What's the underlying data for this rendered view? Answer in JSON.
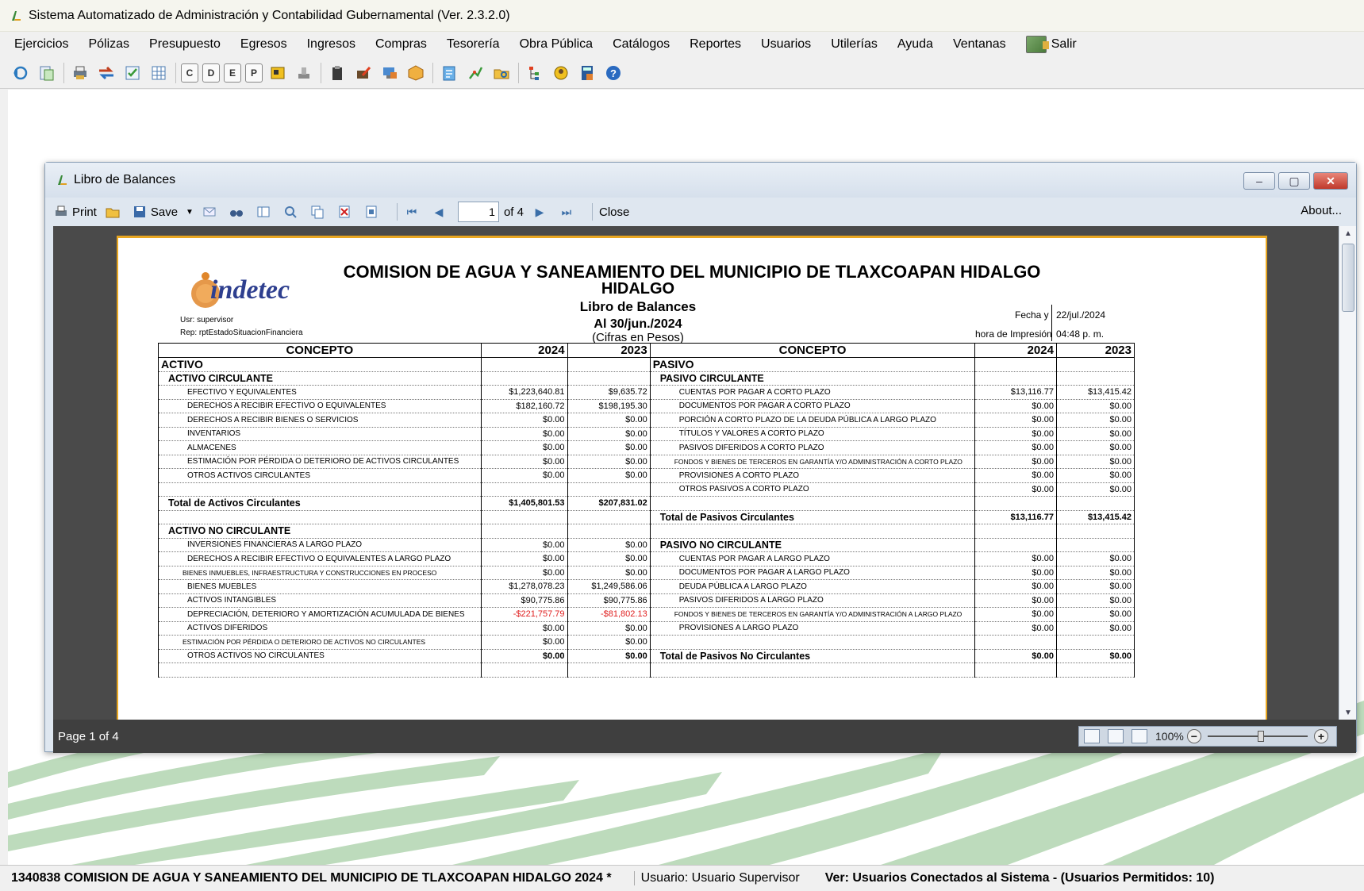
{
  "app": {
    "title": "Sistema Automatizado de Administración y Contabilidad Gubernamental  (Ver. 2.3.2.0)",
    "menu": [
      "Ejercicios",
      "Pólizas",
      "Presupuesto",
      "Egresos",
      "Ingresos",
      "Compras",
      "Tesorería",
      "Obra Pública",
      "Catálogos",
      "Reportes",
      "Usuarios",
      "Utilerías",
      "Ayuda",
      "Ventanas"
    ],
    "exit_label": "Salir",
    "toolbar_letters": [
      "C",
      "D",
      "E",
      "P"
    ]
  },
  "report_window": {
    "title": "Libro de Balances",
    "toolbar": {
      "print": "Print",
      "save": "Save",
      "page_value": "1",
      "page_of": "of 4",
      "close": "Close",
      "about": "About..."
    },
    "status": "Page 1 of 4",
    "zoom": "100%"
  },
  "report": {
    "org_title": "COMISION DE AGUA Y SANEAMIENTO DEL MUNICIPIO DE TLAXCOAPAN HIDALGO",
    "org_title2": "HIDALGO",
    "name": "Libro de Balances",
    "date": "Al 30/jun./2024",
    "units": "(Cifras en Pesos)",
    "usr": "Usr: supervisor",
    "rep": "Rep: rptEstadoSituacionFinanciera",
    "fecha_label": "Fecha y",
    "fecha_value": "22/jul./2024",
    "hora_label": "hora de Impresión",
    "hora_value": "04:48 p. m.",
    "logo_text": "indetec",
    "headers": {
      "concepto": "CONCEPTO",
      "y1": "2024",
      "y2": "2023"
    },
    "rows": [
      {
        "l": "ACTIVO",
        "lt": "sec",
        "a": "",
        "b": "",
        "r": "PASIVO",
        "rt": "sec",
        "c": "",
        "d": ""
      },
      {
        "l": "ACTIVO CIRCULANTE",
        "lt": "sub",
        "a": "",
        "b": "",
        "r": "PASIVO CIRCULANTE",
        "rt": "sub",
        "c": "",
        "d": ""
      },
      {
        "l": "EFECTIVO Y EQUIVALENTES",
        "lt": "item",
        "a": "$1,223,640.81",
        "b": "$9,635.72",
        "r": "CUENTAS POR PAGAR A CORTO PLAZO",
        "rt": "item",
        "c": "$13,116.77",
        "d": "$13,415.42"
      },
      {
        "l": "DERECHOS A RECIBIR EFECTIVO O EQUIVALENTES",
        "lt": "item",
        "a": "$182,160.72",
        "b": "$198,195.30",
        "r": "DOCUMENTOS POR PAGAR A CORTO PLAZO",
        "rt": "item",
        "c": "$0.00",
        "d": "$0.00"
      },
      {
        "l": "DERECHOS A RECIBIR BIENES O SERVICIOS",
        "lt": "item",
        "a": "$0.00",
        "b": "$0.00",
        "r": "PORCIÓN A CORTO PLAZO DE LA DEUDA PÚBLICA A LARGO PLAZO",
        "rt": "item",
        "c": "$0.00",
        "d": "$0.00"
      },
      {
        "l": "INVENTARIOS",
        "lt": "item",
        "a": "$0.00",
        "b": "$0.00",
        "r": "TÍTULOS Y VALORES A CORTO PLAZO",
        "rt": "item",
        "c": "$0.00",
        "d": "$0.00"
      },
      {
        "l": "ALMACENES",
        "lt": "item",
        "a": "$0.00",
        "b": "$0.00",
        "r": "PASIVOS DIFERIDOS A CORTO PLAZO",
        "rt": "item",
        "c": "$0.00",
        "d": "$0.00"
      },
      {
        "l": "ESTIMACIÓN POR PÉRDIDA O DETERIORO DE ACTIVOS CIRCULANTES",
        "lt": "item",
        "a": "$0.00",
        "b": "$0.00",
        "r": "FONDOS Y BIENES DE TERCEROS EN GARANTÍA Y/O ADMINISTRACIÓN A CORTO PLAZO",
        "rt": "item small",
        "c": "$0.00",
        "d": "$0.00"
      },
      {
        "l": "OTROS ACTIVOS CIRCULANTES",
        "lt": "item",
        "a": "$0.00",
        "b": "$0.00",
        "r": "PROVISIONES A CORTO PLAZO",
        "rt": "item",
        "c": "$0.00",
        "d": "$0.00"
      },
      {
        "l": "",
        "lt": "item",
        "a": "",
        "b": "",
        "r": "OTROS PASIVOS A CORTO PLAZO",
        "rt": "item",
        "c": "$0.00",
        "d": "$0.00"
      },
      {
        "l": "Total de Activos Circulantes",
        "lt": "tot",
        "a": "$1,405,801.53",
        "b": "$207,831.02",
        "r": "",
        "rt": "item",
        "c": "",
        "d": "",
        "tv": true
      },
      {
        "l": "",
        "lt": "item",
        "a": "",
        "b": "",
        "r": "Total de Pasivos Circulantes",
        "rt": "tot",
        "c": "$13,116.77",
        "d": "$13,415.42",
        "tv": true
      },
      {
        "l": "ACTIVO NO CIRCULANTE",
        "lt": "sub",
        "a": "",
        "b": "",
        "r": "",
        "rt": "item",
        "c": "",
        "d": ""
      },
      {
        "l": "INVERSIONES FINANCIERAS A LARGO PLAZO",
        "lt": "item",
        "a": "$0.00",
        "b": "$0.00",
        "r": "PASIVO NO CIRCULANTE",
        "rt": "sub",
        "c": "",
        "d": ""
      },
      {
        "l": "DERECHOS A RECIBIR EFECTIVO O EQUIVALENTES A LARGO PLAZO",
        "lt": "item",
        "a": "$0.00",
        "b": "$0.00",
        "r": "CUENTAS POR PAGAR A LARGO PLAZO",
        "rt": "item",
        "c": "$0.00",
        "d": "$0.00"
      },
      {
        "l": "BIENES INMUEBLES, INFRAESTRUCTURA Y CONSTRUCCIONES EN PROCESO",
        "lt": "item small",
        "a": "$0.00",
        "b": "$0.00",
        "r": "DOCUMENTOS POR PAGAR A LARGO PLAZO",
        "rt": "item",
        "c": "$0.00",
        "d": "$0.00"
      },
      {
        "l": "BIENES MUEBLES",
        "lt": "item",
        "a": "$1,278,078.23",
        "b": "$1,249,586.06",
        "r": "DEUDA PÚBLICA A LARGO PLAZO",
        "rt": "item",
        "c": "$0.00",
        "d": "$0.00"
      },
      {
        "l": "ACTIVOS INTANGIBLES",
        "lt": "item",
        "a": "$90,775.86",
        "b": "$90,775.86",
        "r": "PASIVOS DIFERIDOS A LARGO PLAZO",
        "rt": "item",
        "c": "$0.00",
        "d": "$0.00"
      },
      {
        "l": "DEPRECIACIÓN, DETERIORO Y AMORTIZACIÓN ACUMULADA DE BIENES",
        "lt": "item",
        "a": "-$221,757.79",
        "b": "-$81,802.13",
        "neg": true,
        "r": "FONDOS Y BIENES DE TERCEROS EN GARANTÍA Y/O ADMINISTRACIÓN A LARGO PLAZO",
        "rt": "item small",
        "c": "$0.00",
        "d": "$0.00"
      },
      {
        "l": "ACTIVOS DIFERIDOS",
        "lt": "item",
        "a": "$0.00",
        "b": "$0.00",
        "r": "PROVISIONES A LARGO PLAZO",
        "rt": "item",
        "c": "$0.00",
        "d": "$0.00"
      },
      {
        "l": "ESTIMACIÓN POR PÉRDIDA O DETERIORO DE ACTIVOS NO CIRCULANTES",
        "lt": "item small",
        "a": "$0.00",
        "b": "$0.00",
        "r": "",
        "rt": "item",
        "c": "",
        "d": ""
      },
      {
        "l": "OTROS ACTIVOS NO CIRCULANTES",
        "lt": "item",
        "a": "$0.00",
        "b": "$0.00",
        "r": "Total de Pasivos No Circulantes",
        "rt": "tot",
        "c": "$0.00",
        "d": "$0.00",
        "tv": true
      },
      {
        "l": "",
        "lt": "item",
        "a": "",
        "b": "",
        "r": "",
        "rt": "item",
        "c": "",
        "d": ""
      }
    ]
  },
  "statusbar": {
    "company": "1340838 COMISION DE AGUA Y SANEAMIENTO DEL MUNICIPIO DE TLAXCOAPAN HIDALGO  2024   *",
    "user": "Usuario: Usuario Supervisor",
    "connected": "Ver: Usuarios Conectados al Sistema - (Usuarios Permitidos: 10)"
  }
}
